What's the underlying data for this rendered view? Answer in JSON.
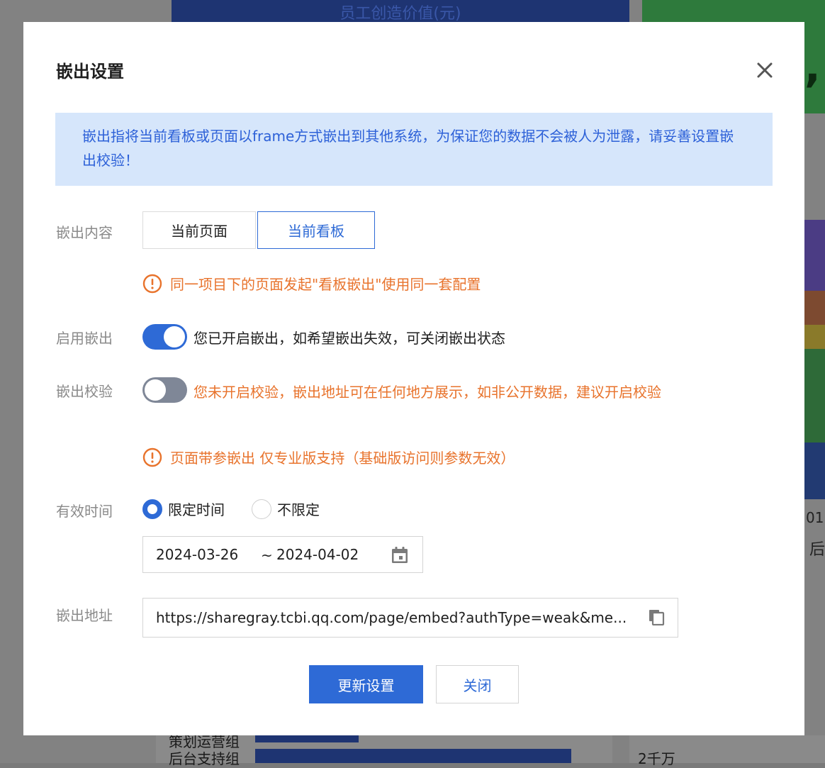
{
  "background": {
    "top_chart_title": "员工创造价值(元)",
    "right_text_01": "01",
    "right_text_hou": "后",
    "row1_label": "策划运营组",
    "row2_label": "后台支持组",
    "right_bottom_value": "2千万"
  },
  "modal": {
    "title": "嵌出设置",
    "notice": "嵌出指将当前看板或页面以frame方式嵌出到其他系统，为保证您的数据不会被人为泄露，请妥善设置嵌出校验！",
    "content": {
      "label": "嵌出内容",
      "options": [
        "当前页面",
        "当前看板"
      ],
      "selected": "当前看板",
      "warning": "同一项目下的页面发起\"看板嵌出\"使用同一套配置"
    },
    "enable": {
      "label": "启用嵌出",
      "on": true,
      "text": "您已开启嵌出，如希望嵌出失效，可关闭嵌出状态"
    },
    "verify": {
      "label": "嵌出校验",
      "on": false,
      "text": "您未开启校验，嵌出地址可在任何地方展示，如非公开数据，建议开启校验"
    },
    "param_warning": "页面带参嵌出 仅专业版支持（基础版访问则参数无效）",
    "validity": {
      "label": "有效时间",
      "options": [
        "限定时间",
        "不限定"
      ],
      "selected": "限定时间",
      "start": "2024-03-26",
      "separator": "~",
      "end": "2024-04-02"
    },
    "url": {
      "label": "嵌出地址",
      "value": "https://sharegray.tcbi.qq.com/page/embed?authType=weak&me..."
    },
    "buttons": {
      "update": "更新设置",
      "close": "关闭"
    }
  },
  "colors": {
    "primary": "#2e6ad6",
    "warning": "#e8732c",
    "notice_bg": "#d6e6fb"
  }
}
